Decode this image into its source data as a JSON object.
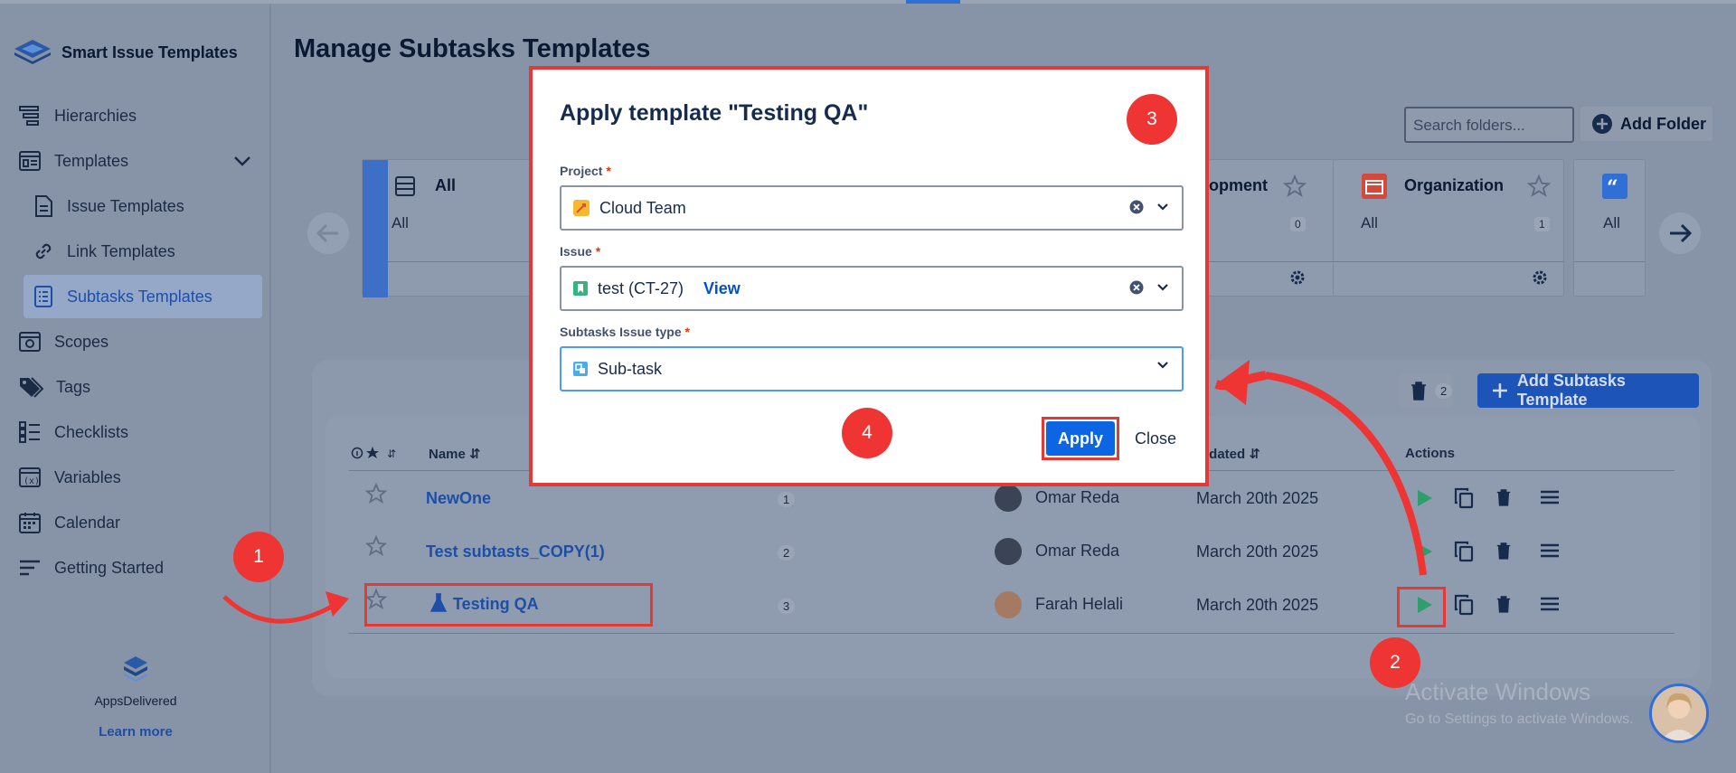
{
  "app": {
    "name": "Smart Issue Templates"
  },
  "sidebar": {
    "items": [
      {
        "label": "Hierarchies"
      },
      {
        "label": "Templates"
      },
      {
        "label": "Issue Templates"
      },
      {
        "label": "Link Templates"
      },
      {
        "label": "Subtasks Templates"
      },
      {
        "label": "Scopes"
      },
      {
        "label": "Tags"
      },
      {
        "label": "Checklists"
      },
      {
        "label": "Variables"
      },
      {
        "label": "Calendar"
      },
      {
        "label": "Getting Started"
      }
    ],
    "footer": {
      "org": "AppsDelivered",
      "learn_more": "Learn more"
    }
  },
  "page": {
    "title": "Manage Subtasks Templates"
  },
  "toolbar": {
    "search_placeholder": "Search folders...",
    "add_folder_label": "Add Folder",
    "trash_count": "2",
    "add_template_label": "Add Subtasks Template"
  },
  "folders": [
    {
      "name": "All",
      "sub": "All"
    },
    {
      "name": "opment",
      "sub": "",
      "count": "0"
    },
    {
      "name": "Organization",
      "sub": "All",
      "count": "1"
    },
    {
      "name": "",
      "sub": "All"
    }
  ],
  "table": {
    "headers": {
      "name": "Name",
      "updated": "pdated",
      "actions": "Actions"
    },
    "rows": [
      {
        "name": "NewOne",
        "count": "1",
        "author": "Omar Reda",
        "updated": "March 20th 2025"
      },
      {
        "name": "Test subtasts_COPY(1)",
        "count": "2",
        "author": "Omar Reda",
        "updated": "March 20th 2025"
      },
      {
        "name": "Testing QA",
        "count": "3",
        "author": "Farah Helali",
        "updated": "March 20th 2025"
      }
    ]
  },
  "modal": {
    "title": "Apply template \"Testing QA\"",
    "project_label": "Project",
    "project_value": "Cloud Team",
    "issue_label": "Issue",
    "issue_value": "test (CT-27)",
    "issue_view": "View",
    "type_label": "Subtasks Issue type",
    "type_value": "Sub-task",
    "required_mark": "*",
    "apply_label": "Apply",
    "close_label": "Close"
  },
  "annotations": {
    "m1": "1",
    "m2": "2",
    "m3": "3",
    "m4": "4"
  },
  "watermark": {
    "line1": "Activate Windows",
    "line2": "Go to Settings to activate Windows."
  },
  "colors": {
    "annotation_red": "#e53935",
    "primary_blue": "#0c66e4",
    "play_green": "#36b37e"
  }
}
